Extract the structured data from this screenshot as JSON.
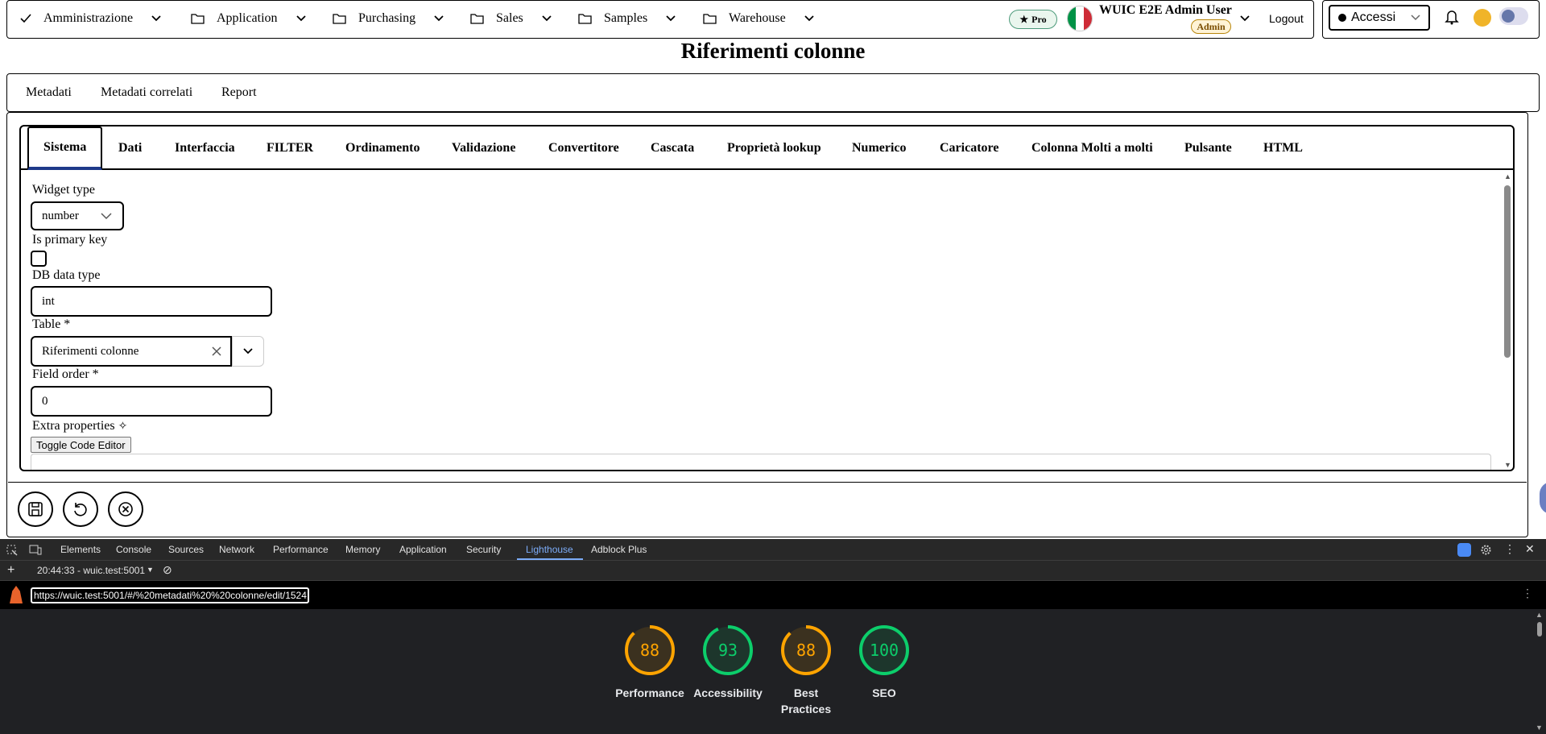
{
  "topnav": {
    "items": [
      {
        "label": "Amministrazione",
        "icon": "check-icon"
      },
      {
        "label": "Application",
        "icon": "folder-icon"
      },
      {
        "label": "Purchasing",
        "icon": "folder-icon"
      },
      {
        "label": "Sales",
        "icon": "folder-icon"
      },
      {
        "label": "Samples",
        "icon": "folder-icon"
      },
      {
        "label": "Warehouse",
        "icon": "folder-icon"
      }
    ],
    "pro_badge": "Pro",
    "user_name": "WUIC E2E Admin User",
    "role_badge": "Admin",
    "logout": "Logout",
    "accessibility_select": "Accessi"
  },
  "page": {
    "title": "Riferimenti colonne"
  },
  "main_tabs": [
    "Metadati",
    "Metadati correlati",
    "Report"
  ],
  "sub_tabs": [
    "Sistema",
    "Dati",
    "Interfaccia",
    "FILTER",
    "Ordinamento",
    "Validazione",
    "Convertitore",
    "Cascata",
    "Proprietà lookup",
    "Numerico",
    "Caricatore",
    "Colonna Molti a molti",
    "Pulsante",
    "HTML"
  ],
  "form": {
    "widget_type_label": "Widget type",
    "widget_type_value": "number",
    "is_primary_key_label": "Is primary key",
    "db_data_type_label": "DB data type",
    "db_data_type_value": "int",
    "table_label": "Table *",
    "table_value": "Riferimenti colonne",
    "field_order_label": "Field order *",
    "field_order_value": "0",
    "extra_properties_label": "Extra properties",
    "toggle_code_editor": "Toggle Code Editor"
  },
  "devtools": {
    "tabs": [
      "Elements",
      "Console",
      "Sources",
      "Network",
      "Performance",
      "Memory",
      "Application",
      "Security",
      "Lighthouse",
      "Adblock Plus"
    ],
    "active_tab": "Lighthouse",
    "report_time": "20:44:33 - wuic.test:5001",
    "url": "https://wuic.test:5001/#/%20metadati%20%20colonne/edit/1524"
  },
  "lighthouse": {
    "scores": [
      {
        "label": "Performance",
        "value": 88,
        "color": "#ffa400"
      },
      {
        "label": "Accessibility",
        "value": 93,
        "color": "#0cce6b"
      },
      {
        "label": "Best Practices",
        "value": 88,
        "color": "#ffa400"
      },
      {
        "label": "SEO",
        "value": 100,
        "color": "#0cce6b"
      }
    ]
  },
  "colors": {
    "active_tab_underline": "#1e3a8a",
    "devtools_bg": "#282828",
    "lighthouse_bg": "#202124",
    "devtools_accent": "#7cacf8"
  }
}
